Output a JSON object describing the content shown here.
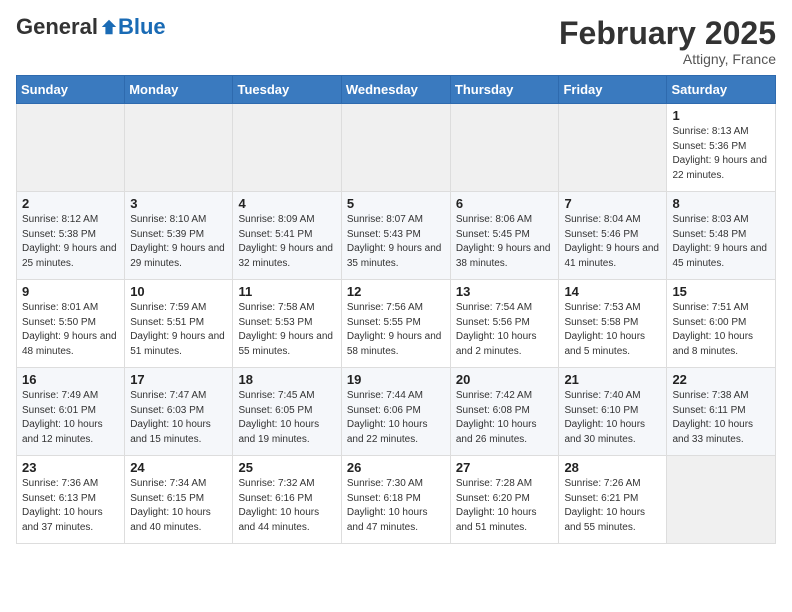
{
  "logo": {
    "general": "General",
    "blue": "Blue"
  },
  "header": {
    "month": "February 2025",
    "location": "Attigny, France"
  },
  "days_of_week": [
    "Sunday",
    "Monday",
    "Tuesday",
    "Wednesday",
    "Thursday",
    "Friday",
    "Saturday"
  ],
  "weeks": [
    [
      {
        "day": "",
        "detail": ""
      },
      {
        "day": "",
        "detail": ""
      },
      {
        "day": "",
        "detail": ""
      },
      {
        "day": "",
        "detail": ""
      },
      {
        "day": "",
        "detail": ""
      },
      {
        "day": "",
        "detail": ""
      },
      {
        "day": "1",
        "detail": "Sunrise: 8:13 AM\nSunset: 5:36 PM\nDaylight: 9 hours and 22 minutes."
      }
    ],
    [
      {
        "day": "2",
        "detail": "Sunrise: 8:12 AM\nSunset: 5:38 PM\nDaylight: 9 hours and 25 minutes."
      },
      {
        "day": "3",
        "detail": "Sunrise: 8:10 AM\nSunset: 5:39 PM\nDaylight: 9 hours and 29 minutes."
      },
      {
        "day": "4",
        "detail": "Sunrise: 8:09 AM\nSunset: 5:41 PM\nDaylight: 9 hours and 32 minutes."
      },
      {
        "day": "5",
        "detail": "Sunrise: 8:07 AM\nSunset: 5:43 PM\nDaylight: 9 hours and 35 minutes."
      },
      {
        "day": "6",
        "detail": "Sunrise: 8:06 AM\nSunset: 5:45 PM\nDaylight: 9 hours and 38 minutes."
      },
      {
        "day": "7",
        "detail": "Sunrise: 8:04 AM\nSunset: 5:46 PM\nDaylight: 9 hours and 41 minutes."
      },
      {
        "day": "8",
        "detail": "Sunrise: 8:03 AM\nSunset: 5:48 PM\nDaylight: 9 hours and 45 minutes."
      }
    ],
    [
      {
        "day": "9",
        "detail": "Sunrise: 8:01 AM\nSunset: 5:50 PM\nDaylight: 9 hours and 48 minutes."
      },
      {
        "day": "10",
        "detail": "Sunrise: 7:59 AM\nSunset: 5:51 PM\nDaylight: 9 hours and 51 minutes."
      },
      {
        "day": "11",
        "detail": "Sunrise: 7:58 AM\nSunset: 5:53 PM\nDaylight: 9 hours and 55 minutes."
      },
      {
        "day": "12",
        "detail": "Sunrise: 7:56 AM\nSunset: 5:55 PM\nDaylight: 9 hours and 58 minutes."
      },
      {
        "day": "13",
        "detail": "Sunrise: 7:54 AM\nSunset: 5:56 PM\nDaylight: 10 hours and 2 minutes."
      },
      {
        "day": "14",
        "detail": "Sunrise: 7:53 AM\nSunset: 5:58 PM\nDaylight: 10 hours and 5 minutes."
      },
      {
        "day": "15",
        "detail": "Sunrise: 7:51 AM\nSunset: 6:00 PM\nDaylight: 10 hours and 8 minutes."
      }
    ],
    [
      {
        "day": "16",
        "detail": "Sunrise: 7:49 AM\nSunset: 6:01 PM\nDaylight: 10 hours and 12 minutes."
      },
      {
        "day": "17",
        "detail": "Sunrise: 7:47 AM\nSunset: 6:03 PM\nDaylight: 10 hours and 15 minutes."
      },
      {
        "day": "18",
        "detail": "Sunrise: 7:45 AM\nSunset: 6:05 PM\nDaylight: 10 hours and 19 minutes."
      },
      {
        "day": "19",
        "detail": "Sunrise: 7:44 AM\nSunset: 6:06 PM\nDaylight: 10 hours and 22 minutes."
      },
      {
        "day": "20",
        "detail": "Sunrise: 7:42 AM\nSunset: 6:08 PM\nDaylight: 10 hours and 26 minutes."
      },
      {
        "day": "21",
        "detail": "Sunrise: 7:40 AM\nSunset: 6:10 PM\nDaylight: 10 hours and 30 minutes."
      },
      {
        "day": "22",
        "detail": "Sunrise: 7:38 AM\nSunset: 6:11 PM\nDaylight: 10 hours and 33 minutes."
      }
    ],
    [
      {
        "day": "23",
        "detail": "Sunrise: 7:36 AM\nSunset: 6:13 PM\nDaylight: 10 hours and 37 minutes."
      },
      {
        "day": "24",
        "detail": "Sunrise: 7:34 AM\nSunset: 6:15 PM\nDaylight: 10 hours and 40 minutes."
      },
      {
        "day": "25",
        "detail": "Sunrise: 7:32 AM\nSunset: 6:16 PM\nDaylight: 10 hours and 44 minutes."
      },
      {
        "day": "26",
        "detail": "Sunrise: 7:30 AM\nSunset: 6:18 PM\nDaylight: 10 hours and 47 minutes."
      },
      {
        "day": "27",
        "detail": "Sunrise: 7:28 AM\nSunset: 6:20 PM\nDaylight: 10 hours and 51 minutes."
      },
      {
        "day": "28",
        "detail": "Sunrise: 7:26 AM\nSunset: 6:21 PM\nDaylight: 10 hours and 55 minutes."
      },
      {
        "day": "",
        "detail": ""
      }
    ]
  ]
}
